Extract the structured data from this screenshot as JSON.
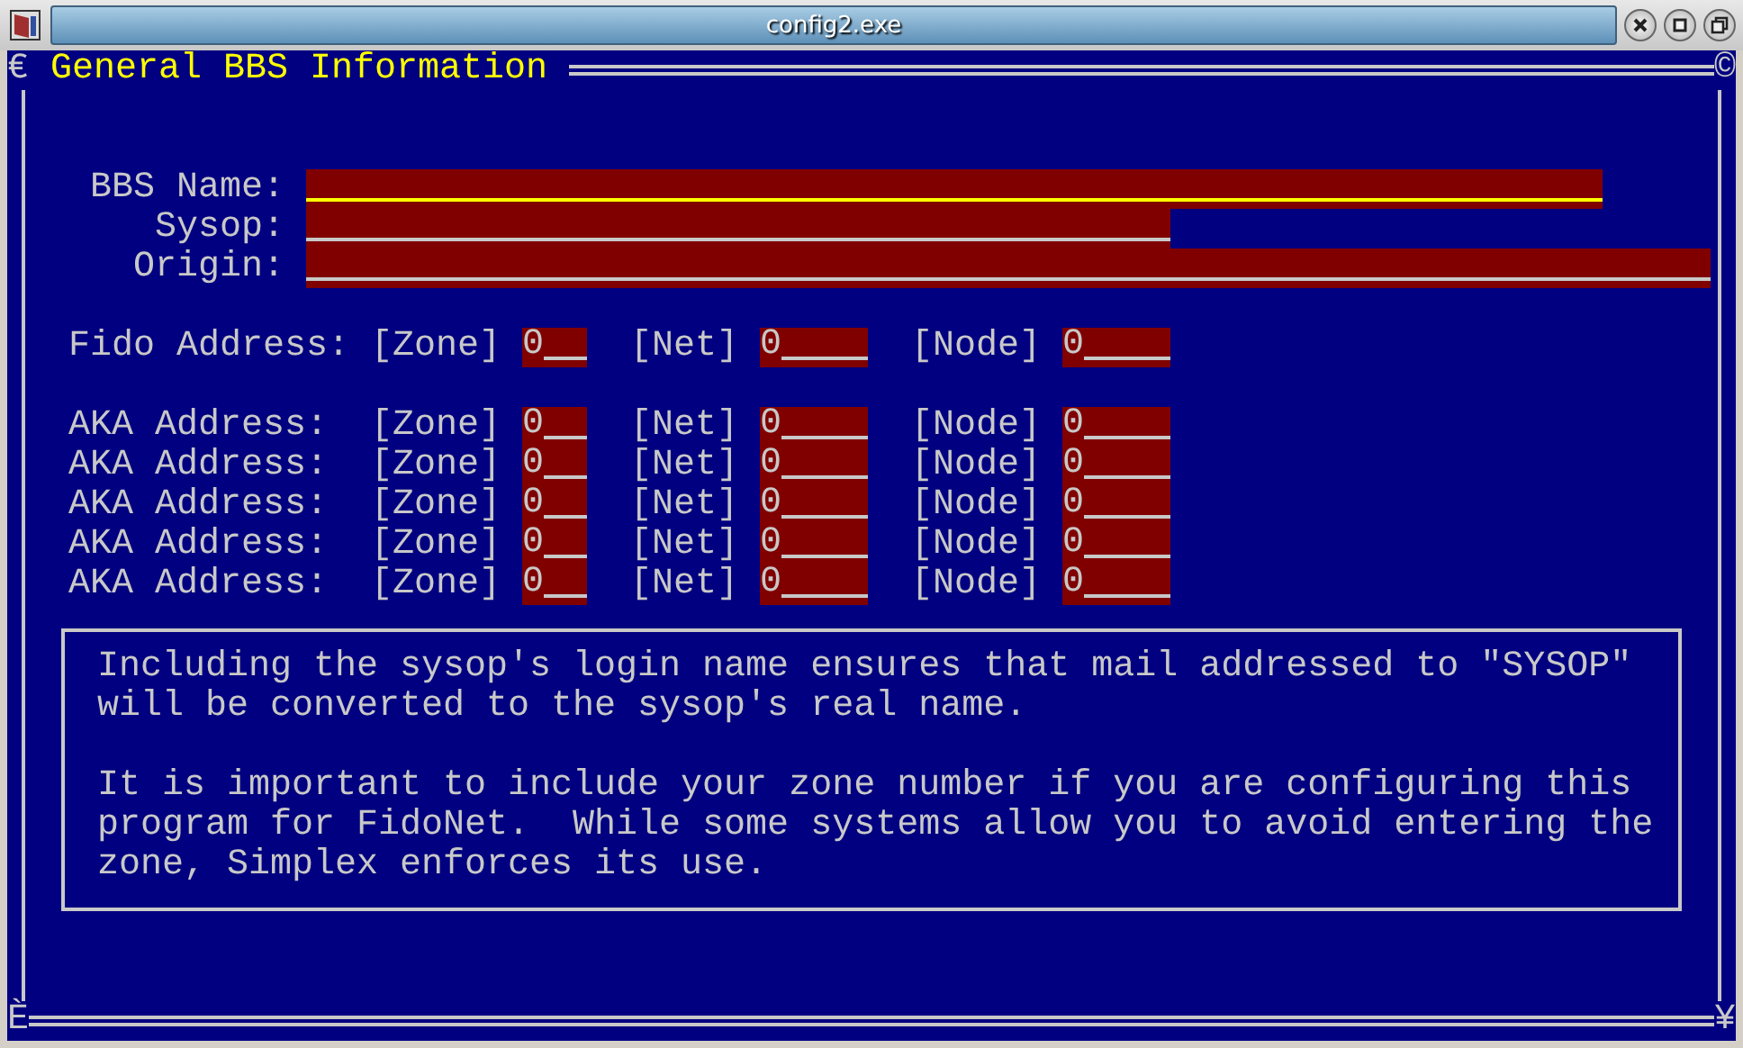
{
  "window": {
    "title": "config2.exe"
  },
  "screen": {
    "title": "General BBS Information",
    "corners": [
      "€",
      "©",
      "È",
      "¥"
    ]
  },
  "text_fields": [
    {
      "label": "BBS Name:",
      "focused": true
    },
    {
      "label": "Sysop:",
      "focused": false
    },
    {
      "label": "Origin:",
      "focused": false
    }
  ],
  "addresses": [
    {
      "label": "Fido Address:",
      "zone_label": "[Zone]",
      "zone": "0",
      "net_label": "[Net]",
      "net": "0",
      "node_label": "[Node]",
      "node": "0"
    },
    {
      "label": "AKA Address:",
      "zone_label": "[Zone]",
      "zone": "0",
      "net_label": "[Net]",
      "net": "0",
      "node_label": "[Node]",
      "node": "0"
    },
    {
      "label": "AKA Address:",
      "zone_label": "[Zone]",
      "zone": "0",
      "net_label": "[Net]",
      "net": "0",
      "node_label": "[Node]",
      "node": "0"
    },
    {
      "label": "AKA Address:",
      "zone_label": "[Zone]",
      "zone": "0",
      "net_label": "[Net]",
      "net": "0",
      "node_label": "[Node]",
      "node": "0"
    },
    {
      "label": "AKA Address:",
      "zone_label": "[Zone]",
      "zone": "0",
      "net_label": "[Net]",
      "net": "0",
      "node_label": "[Node]",
      "node": "0"
    },
    {
      "label": "AKA Address:",
      "zone_label": "[Zone]",
      "zone": "0",
      "net_label": "[Net]",
      "net": "0",
      "node_label": "[Node]",
      "node": "0"
    }
  ],
  "help": [
    [
      "Including the sysop's login name ensures that mail addressed to \"SYSOP\"",
      "will be converted to the sysop's real name."
    ],
    [
      "It is important to include your zone number if you are configuring this",
      "program for FidoNet.  While some systems allow you to avoid entering the",
      "zone, Simplex enforces its use."
    ]
  ]
}
